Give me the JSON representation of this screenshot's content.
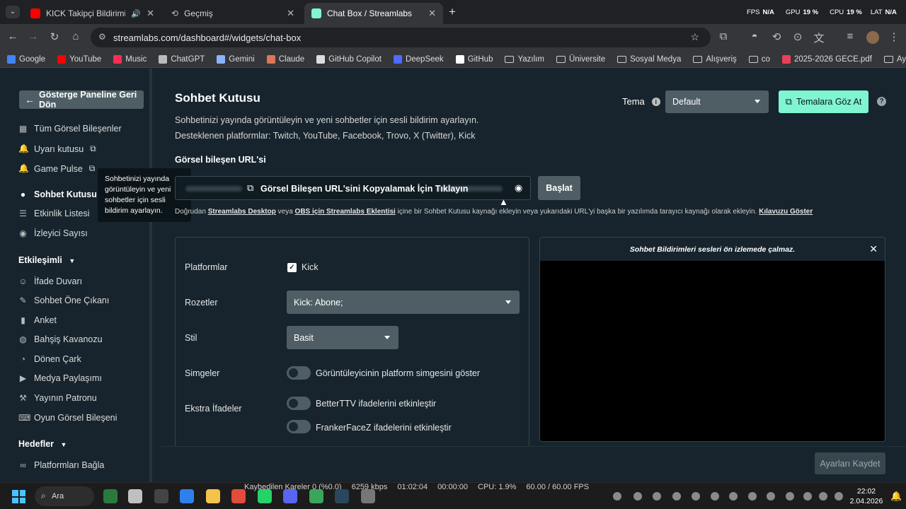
{
  "browser": {
    "tabs": [
      {
        "title": "KICK Takipçi Bildirimi ve Ek",
        "favicon_color": "#ff0000"
      },
      {
        "title": "Geçmiş",
        "favicon_color": "#9aa0a6"
      },
      {
        "title": "Chat Box / Streamlabs",
        "favicon_color": "#80f5d2"
      }
    ],
    "perf": {
      "fps_label": "FPS",
      "fps_value": "N/A",
      "gpu_label": "GPU",
      "gpu_value": "19 %",
      "cpu_label": "CPU",
      "cpu_value": "19 %",
      "lat_label": "LAT",
      "lat_value": "N/A"
    },
    "url": "streamlabs.com/dashboard#/widgets/chat-box",
    "bookmarks": [
      {
        "label": "Google",
        "color": "#4285f4"
      },
      {
        "label": "YouTube",
        "color": "#ff0000"
      },
      {
        "label": "Music",
        "color": "#ff2d55"
      },
      {
        "label": "ChatGPT",
        "color": "#bbbbbb"
      },
      {
        "label": "Gemini",
        "color": "#8ab4f8"
      },
      {
        "label": "Claude",
        "color": "#d97757"
      },
      {
        "label": "GitHub Copilot",
        "color": "#dddddd"
      },
      {
        "label": "DeepSeek",
        "color": "#4d6bfe"
      },
      {
        "label": "GitHub",
        "color": "#ffffff"
      },
      {
        "label": "Yazılım",
        "folder": true
      },
      {
        "label": "Üniversite",
        "folder": true
      },
      {
        "label": "Sosyal Medya",
        "folder": true
      },
      {
        "label": "Alışveriş",
        "folder": true
      },
      {
        "label": "co",
        "folder": true
      },
      {
        "label": "2025-2026 GECE.pdf",
        "color": "#e94057"
      },
      {
        "label": "AysSoft",
        "folder": true
      }
    ]
  },
  "sidebar": {
    "back_label": "Gösterge Paneline Geri Dön",
    "items": [
      {
        "label": "Tüm Görsel Bileşenler",
        "icon": "grid-icon"
      },
      {
        "label": "Uyarı kutusu",
        "icon": "bell-icon",
        "external": true
      },
      {
        "label": "Game Pulse",
        "icon": "bell-icon",
        "external": true
      },
      {
        "label": "Sohbet Kutusu",
        "icon": "chat-icon",
        "active": true
      },
      {
        "label": "Etkinlik Listesi",
        "icon": "list-icon"
      },
      {
        "label": "İzleyici Sayısı",
        "icon": "eye-icon"
      }
    ],
    "section_engagement": "Etkileşimli",
    "engagement_items": [
      {
        "label": "İfade Duvarı",
        "icon": "smile-icon"
      },
      {
        "label": "Sohbet Öne Çıkanı",
        "icon": "pen-icon"
      },
      {
        "label": "Anket",
        "icon": "bar-icon"
      },
      {
        "label": "Bahşiş Kavanozu",
        "icon": "jar-icon"
      },
      {
        "label": "Dönen Çark",
        "icon": "wheel-icon"
      },
      {
        "label": "Medya Paylaşımı",
        "icon": "play-icon"
      },
      {
        "label": "Yayının Patronu",
        "icon": "hammer-icon"
      },
      {
        "label": "Oyun Görsel Bileşeni",
        "icon": "gamepad-icon"
      }
    ],
    "section_goals": "Hedefler",
    "goals_items": [
      {
        "label": "Platformları Bağla",
        "icon": "link-icon"
      }
    ],
    "tooltip": "Sohbetinizi yayında görüntüleyin ve yeni sohbetler için sesli bildirim ayarlayın."
  },
  "main": {
    "title": "Sohbet Kutusu",
    "description": "Sohbetinizi yayında görüntüleyin ve yeni sohbetler için sesli bildirim ayarlayın.",
    "platforms_line": "Desteklenen platformlar: Twitch, YouTube, Facebook, Trovo, X (Twitter), Kick",
    "theme_label": "Tema",
    "theme_value": "Default",
    "browse_themes": "Temalara Göz At",
    "url_section_label": "Görsel bileşen URL'si",
    "copy_url_label": "Görsel Bileşen URL'sini Kopyalamak İçin Tıklayın",
    "start_label": "Başlat",
    "note": {
      "prefix": "Doğrudan ",
      "link1": "Streamlabs Desktop",
      "mid1": " veya ",
      "link2": "OBS için Streamlabs Eklentisi",
      "mid2": " içine bir Sohbet Kutusu kaynağı ekleyin veya yukarıdaki URL'yi başka bir yazılımda tarayıcı kaynağı olarak ekleyin. ",
      "link3": "Kılavuzu Göster"
    },
    "settings": {
      "platforms_label": "Platformlar",
      "platform_kick": "Kick",
      "badges_label": "Rozetler",
      "badges_value": "Kick: Abone;",
      "style_label": "Stil",
      "style_value": "Basit",
      "icons_label": "Simgeler",
      "icons_toggle": "Görüntüleyicinin platform simgesini göster",
      "extra_label": "Ekstra İfadeler",
      "bttv_toggle": "BetterTTV ifadelerini etkinleştir",
      "ffz_toggle": "FrankerFaceZ ifadelerini etkinleştir"
    },
    "preview_notice": "Sohbet Bildirimleri sesleri ön izlemede çalmaz.",
    "save_label": "Ayarları Kaydet"
  },
  "taskbar": {
    "search_label": "Ara",
    "obs_stats": [
      "Kaybedilen Kareler 0 (%0.0)",
      "6259 kbps",
      "01:02:04",
      "00:00:00",
      "CPU: 1.9%",
      "60.00 / 60.00 FPS"
    ],
    "time": "22:02",
    "date": "2.04.2026"
  }
}
